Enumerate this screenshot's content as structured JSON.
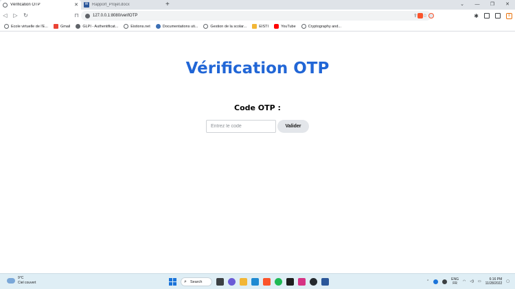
{
  "browser": {
    "tabs": [
      {
        "title": "Vérification OTP",
        "active": true
      },
      {
        "title": "Rapport_Projet.docx",
        "active": false
      }
    ],
    "new_tab": "+",
    "window_controls": {
      "minimize": "—",
      "maximize": "❐",
      "close": "✕"
    },
    "url": "127.0.0.1:8080/verifOTP",
    "bookmarks": [
      {
        "label": "Ecole virtuelle de l'E...",
        "icon": "globe-icon"
      },
      {
        "label": "Gmail",
        "icon": "gmail-icon"
      },
      {
        "label": "GLPI - Authentificat...",
        "icon": "g-icon"
      },
      {
        "label": "Eistions.net",
        "icon": "globe-icon"
      },
      {
        "label": "Documentations uti...",
        "icon": "doc-icon"
      },
      {
        "label": "Gestion de la scolar...",
        "icon": "globe-icon"
      },
      {
        "label": "EISTI",
        "icon": "folder-icon"
      },
      {
        "label": "YouTube",
        "icon": "youtube-icon"
      },
      {
        "label": "Cryptography and...",
        "icon": "globe-icon"
      }
    ]
  },
  "page": {
    "title": "Vérification OTP",
    "code_label": "Code OTP :",
    "input": {
      "placeholder": "Entrez le code",
      "value": ""
    },
    "submit_label": "Valider"
  },
  "taskbar": {
    "weather": {
      "temperature": "9°C",
      "condition": "Ciel couvert"
    },
    "search_label": "Search",
    "language": {
      "line1": "ENG",
      "line2": "FR"
    },
    "clock": {
      "time": "6:16 PM",
      "date": "11/28/2022"
    }
  },
  "colors": {
    "title": "#2166d6",
    "button_bg": "#e3e6ea",
    "taskbar_bg": "#dfeef5"
  }
}
